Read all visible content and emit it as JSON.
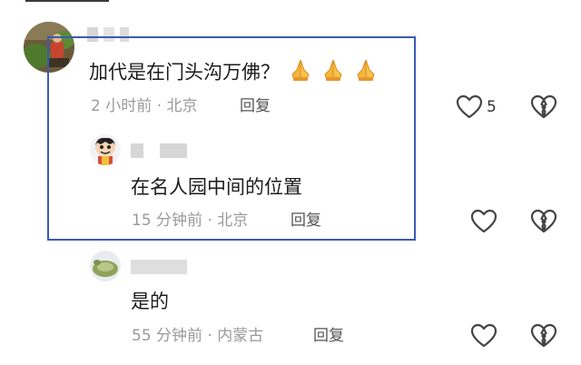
{
  "comments": [
    {
      "text": "加代是在门头沟万佛？",
      "time": "2 小时前",
      "location": "北京",
      "reply_label": "回复",
      "like_count": "5",
      "emoji": [
        "folded-hands",
        "folded-hands",
        "folded-hands"
      ]
    },
    {
      "text": "在名人园中间的位置",
      "time": "15 分钟前",
      "location": "北京",
      "reply_label": "回复",
      "like_count": ""
    },
    {
      "text": "是的",
      "time": "55 分钟前",
      "location": "内蒙古",
      "reply_label": "回复",
      "like_count": ""
    }
  ],
  "meta_separator": "·",
  "colors": {
    "highlight_border": "#3b5bb5",
    "meta_text": "#9a9a9a",
    "icon_stroke": "#444444"
  },
  "icons": {
    "like": "heart-outline-icon",
    "dislike": "broken-heart-icon",
    "emoji": "folded-hands-emoji-icon"
  }
}
